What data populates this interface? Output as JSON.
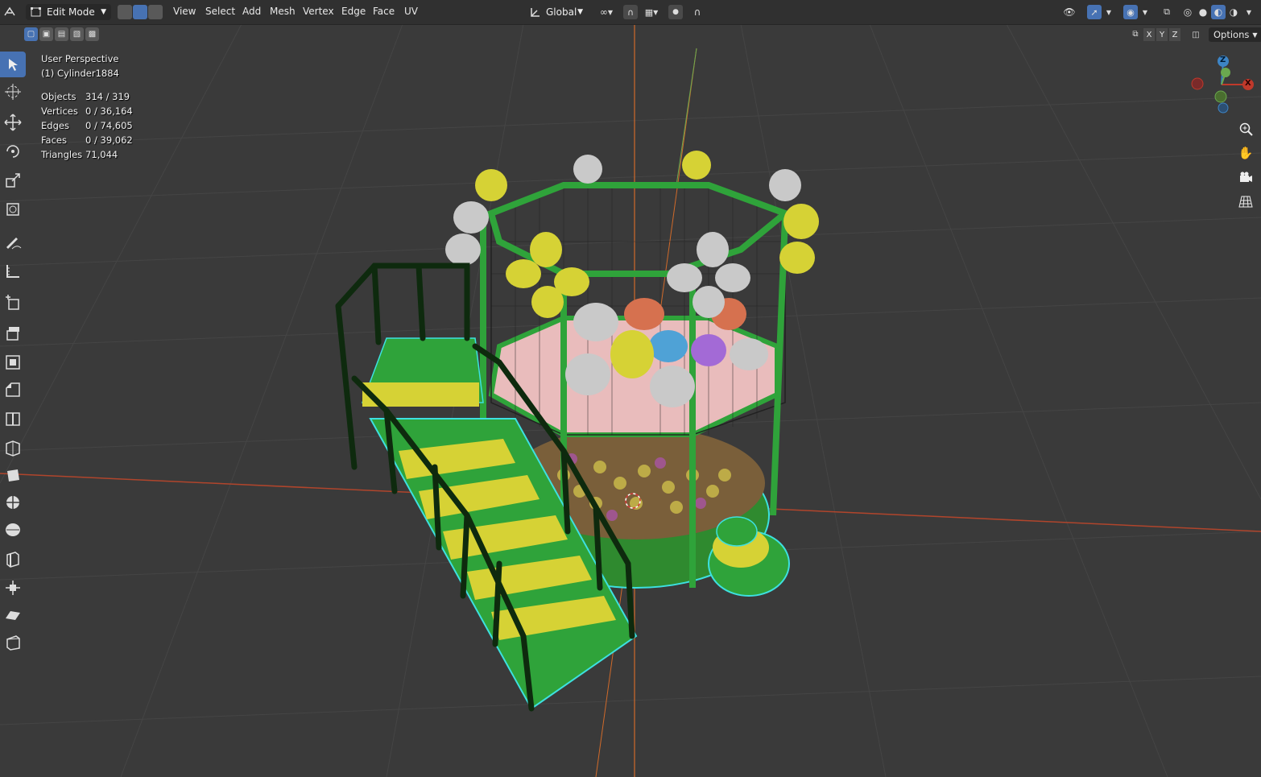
{
  "header": {
    "mode_label": "Edit Mode",
    "menus": [
      "View",
      "Select",
      "Add",
      "Mesh",
      "Vertex",
      "Edge",
      "Face",
      "UV"
    ],
    "transform_orientation": "Global",
    "options_label": "Options",
    "axis_labels": [
      "X",
      "Y",
      "Z"
    ]
  },
  "overlay": {
    "view_name": "User Perspective",
    "object_name": "(1) Cylinder1884",
    "stats": [
      {
        "label": "Objects",
        "value": "314 / 319"
      },
      {
        "label": "Vertices",
        "value": "0 / 36,164"
      },
      {
        "label": "Edges",
        "value": "0 / 74,605"
      },
      {
        "label": "Faces",
        "value": "0 / 39,062"
      },
      {
        "label": "Triangles",
        "value": "71,044"
      }
    ]
  },
  "gizmo": {
    "x_label": "X",
    "z_label": "Z"
  },
  "toolbar": {
    "icons": [
      "select-box-icon",
      "cursor-icon",
      "move-icon",
      "rotate-icon",
      "scale-icon",
      "transform-icon",
      "annotate-icon",
      "measure-icon",
      "add-cube-icon",
      "extrude-icon",
      "inset-icon",
      "bevel-icon",
      "loop-cut-icon",
      "knife-icon",
      "poly-build-icon",
      "spin-icon",
      "smooth-icon",
      "edge-slide-icon",
      "shrink-fatten-icon",
      "shear-icon",
      "rip-icon"
    ]
  },
  "colors": {
    "accent": "#4772b3",
    "x_axis": "#c0392b",
    "y_axis": "#6aa84f",
    "z_axis": "#3d85c6",
    "mesh_green": "#2fa33a",
    "mesh_yellow": "#d6d235",
    "selection_cyan": "#3de0e0"
  }
}
